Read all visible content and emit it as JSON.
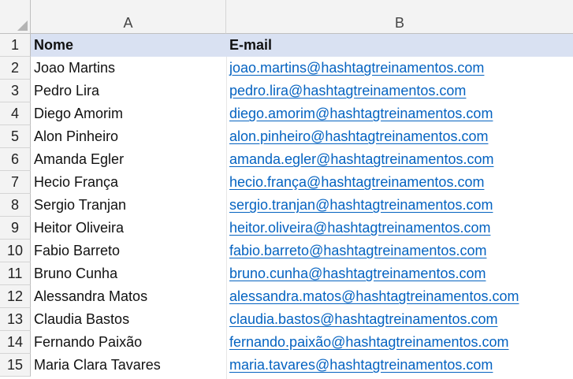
{
  "columns": {
    "corner": "",
    "a": "A",
    "b": "B"
  },
  "header_row": {
    "num": "1",
    "nome": "Nome",
    "email": "E-mail"
  },
  "rows": [
    {
      "num": "2",
      "nome": "Joao Martins",
      "email": "joao.martins@hashtagtreinamentos.com"
    },
    {
      "num": "3",
      "nome": "Pedro Lira",
      "email": "pedro.lira@hashtagtreinamentos.com"
    },
    {
      "num": "4",
      "nome": "Diego Amorim",
      "email": "diego.amorim@hashtagtreinamentos.com"
    },
    {
      "num": "5",
      "nome": "Alon Pinheiro",
      "email": "alon.pinheiro@hashtagtreinamentos.com"
    },
    {
      "num": "6",
      "nome": "Amanda Egler",
      "email": "amanda.egler@hashtagtreinamentos.com"
    },
    {
      "num": "7",
      "nome": "Hecio França",
      "email": "hecio.frança@hashtagtreinamentos.com"
    },
    {
      "num": "8",
      "nome": "Sergio Tranjan",
      "email": "sergio.tranjan@hashtagtreinamentos.com"
    },
    {
      "num": "9",
      "nome": "Heitor Oliveira",
      "email": "heitor.oliveira@hashtagtreinamentos.com"
    },
    {
      "num": "10",
      "nome": "Fabio Barreto",
      "email": "fabio.barreto@hashtagtreinamentos.com"
    },
    {
      "num": "11",
      "nome": "Bruno Cunha",
      "email": "bruno.cunha@hashtagtreinamentos.com"
    },
    {
      "num": "12",
      "nome": "Alessandra Matos",
      "email": "alessandra.matos@hashtagtreinamentos.com"
    },
    {
      "num": "13",
      "nome": "Claudia Bastos",
      "email": "claudia.bastos@hashtagtreinamentos.com"
    },
    {
      "num": "14",
      "nome": "Fernando Paixão",
      "email": "fernando.paixão@hashtagtreinamentos.com"
    },
    {
      "num": "15",
      "nome": "Maria Clara Tavares",
      "email": "maria.tavares@hashtagtreinamentos.com"
    }
  ],
  "colors": {
    "header_fill": "#d9e1f2",
    "link": "#0563c1",
    "gridline": "#d4d4d4"
  }
}
